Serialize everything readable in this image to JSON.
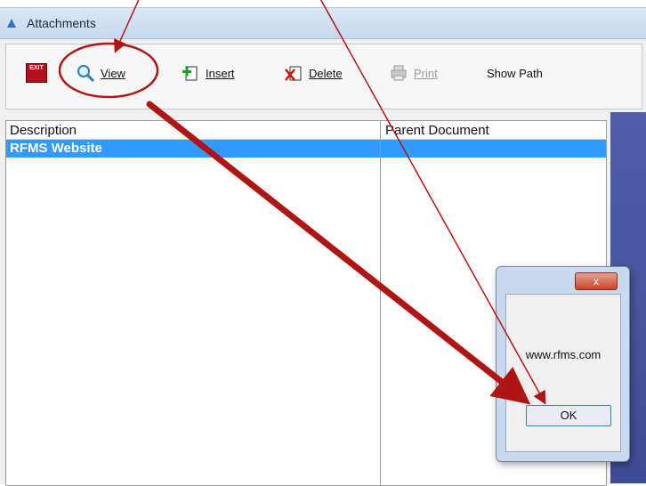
{
  "window": {
    "title": "Attachments"
  },
  "toolbar": {
    "exit_label": "EXIT",
    "view_label": "View",
    "insert_label": "Insert",
    "delete_label": "Delete",
    "print_label": "Print",
    "show_path_label": "Show Path"
  },
  "table": {
    "columns": [
      "Description",
      "Parent Document"
    ],
    "rows": [
      {
        "description": "RFMS Website",
        "parent_document": ""
      }
    ]
  },
  "dialog": {
    "close_symbol": "x",
    "message": "www.rfms.com",
    "ok_label": "OK"
  },
  "icons": {
    "app": "app-icon",
    "exit": "exit-icon",
    "view": "magnifier-icon",
    "insert": "insert-icon",
    "delete": "delete-icon",
    "print": "printer-icon"
  },
  "colors": {
    "selection": "#3399ff",
    "annotation_red": "#b01515",
    "side_panel": "#4a57a0"
  }
}
